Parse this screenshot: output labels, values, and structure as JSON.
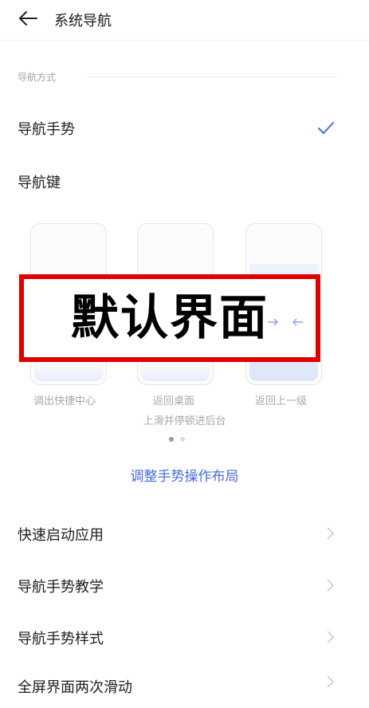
{
  "header": {
    "title": "系统导航"
  },
  "navigation_section": {
    "title": "导航方式",
    "options": [
      {
        "label": "导航手势",
        "selected": true
      },
      {
        "label": "导航键",
        "selected": false
      }
    ]
  },
  "gesture_preview": {
    "cards": [
      {
        "caption": "调出快捷中心"
      },
      {
        "caption": "返回桌面"
      },
      {
        "caption": "返回上一级"
      }
    ],
    "subcaption": "上滑并停顿进后台",
    "page_indicator": {
      "current": 1,
      "total": 2
    },
    "annotation_label": "默认界面",
    "annotation_color": "#e00000"
  },
  "adjust_layout_link": "调整手势操作布局",
  "settings_list": [
    {
      "label": "快速启动应用"
    },
    {
      "label": "导航手势教学"
    },
    {
      "label": "导航手势样式"
    },
    {
      "label": "全屏界面两次滑动"
    }
  ],
  "colors": {
    "accent": "#4a6dd6",
    "check": "#4a6dd6"
  }
}
